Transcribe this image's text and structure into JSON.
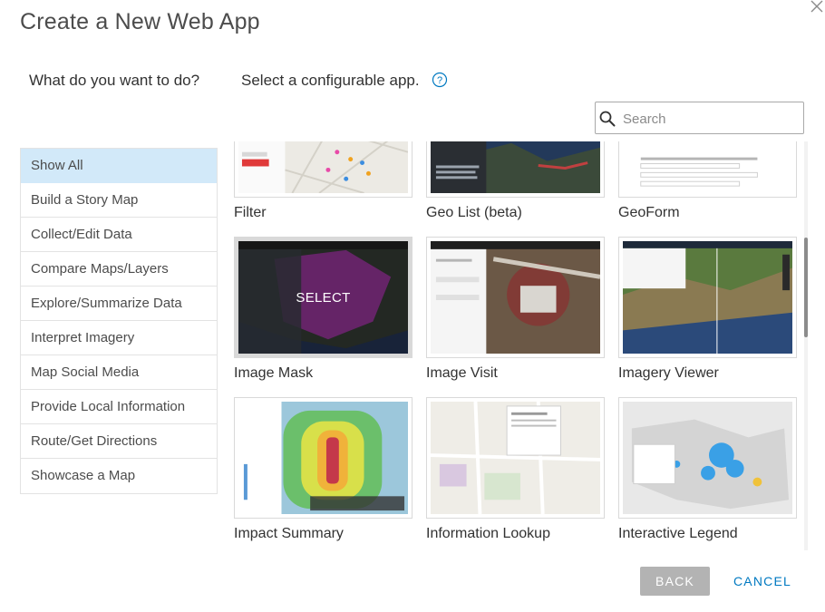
{
  "dialog": {
    "title": "Create a New Web App",
    "close_icon": "close-icon"
  },
  "questions": {
    "left": "What do you want to do?",
    "right": "Select a configurable app.",
    "help_icon": "help-circle-icon"
  },
  "search": {
    "placeholder": "Search",
    "value": "",
    "icon": "search-icon"
  },
  "categories": {
    "active_index": 0,
    "items": [
      {
        "label": "Show All"
      },
      {
        "label": "Build a Story Map"
      },
      {
        "label": "Collect/Edit Data"
      },
      {
        "label": "Compare Maps/Layers"
      },
      {
        "label": "Explore/Summarize Data"
      },
      {
        "label": "Interpret Imagery"
      },
      {
        "label": "Map Social Media"
      },
      {
        "label": "Provide Local Information"
      },
      {
        "label": "Route/Get Directions"
      },
      {
        "label": "Showcase a Map"
      }
    ]
  },
  "apps": [
    {
      "name": "Filter"
    },
    {
      "name": "Geo List (beta)"
    },
    {
      "name": "GeoForm"
    },
    {
      "name": "Image Mask",
      "hover_label": "SELECT"
    },
    {
      "name": "Image Visit"
    },
    {
      "name": "Imagery Viewer"
    },
    {
      "name": "Impact Summary"
    },
    {
      "name": "Information Lookup"
    },
    {
      "name": "Interactive Legend"
    }
  ],
  "footer": {
    "back_label": "BACK",
    "cancel_label": "CANCEL"
  },
  "colors": {
    "accent": "#0079c1",
    "active_category_bg": "#d2e9f9",
    "disabled_button": "#b3b3b3"
  }
}
